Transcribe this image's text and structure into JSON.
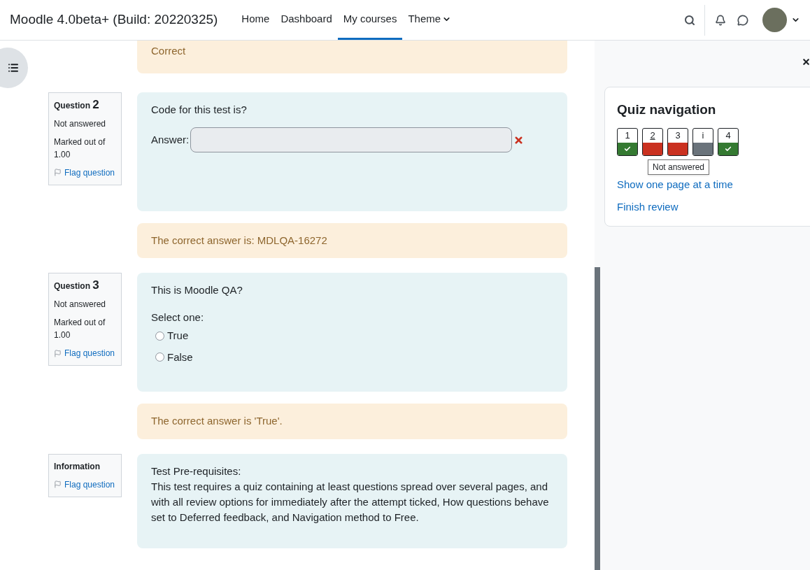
{
  "header": {
    "site_name": "Moodle 4.0beta+ (Build: 20220325)",
    "nav": [
      {
        "label": "Home",
        "selected": false,
        "caret": false
      },
      {
        "label": "Dashboard",
        "selected": false,
        "caret": false
      },
      {
        "label": "My courses",
        "selected": true,
        "caret": false
      },
      {
        "label": "Theme",
        "selected": false,
        "caret": true
      }
    ]
  },
  "top_feedback": "Correct",
  "questions": [
    {
      "kind": "question",
      "label": "Question",
      "number": "2",
      "status": "Not answered",
      "marks_label": "Marked out of",
      "marks": "1.00",
      "flag": "Flag question",
      "text": "Code for this test is?",
      "answer": {
        "label": "Answer:",
        "incorrect": true
      },
      "feedback": "The correct answer is: MDLQA-16272"
    },
    {
      "kind": "choice",
      "label": "Question",
      "number": "3",
      "status": "Not answered",
      "marks_label": "Marked out of",
      "marks": "1.00",
      "flag": "Flag question",
      "text": "This is Moodle QA?",
      "prompt": "Select one:",
      "options": [
        {
          "label": "True",
          "selected": false
        },
        {
          "label": "False",
          "selected": false
        }
      ],
      "feedback": "The correct answer is 'True'."
    },
    {
      "kind": "info",
      "label": "Information",
      "flag": "Flag question",
      "heading": "Test Pre-requisites:",
      "text": "This test requires a quiz containing at least questions spread over several pages, and with all review options for immediately after the attempt ticked, How questions behave set to Deferred feedback, and Navigation method to Free."
    }
  ],
  "quiz_navigation": {
    "title": "Quiz navigation",
    "buttons": [
      {
        "label": "1",
        "kind": "correct",
        "hovered": false
      },
      {
        "label": "2",
        "kind": "notanswered",
        "hovered": true
      },
      {
        "label": "3",
        "kind": "notanswered",
        "hovered": false
      },
      {
        "label": "i",
        "kind": "info",
        "hovered": false
      },
      {
        "label": "4",
        "kind": "correct",
        "hovered": false
      }
    ],
    "tooltip": "Not answered",
    "links": [
      "Show one page at a time",
      "Finish review"
    ]
  }
}
